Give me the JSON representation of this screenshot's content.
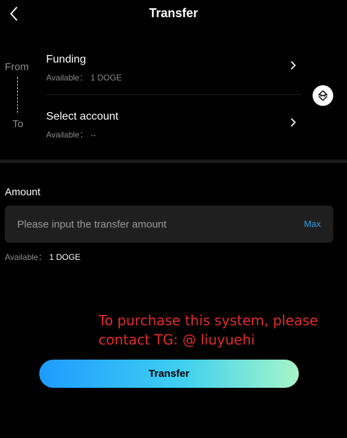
{
  "header": {
    "title": "Transfer",
    "back_icon": "chevron-left-icon"
  },
  "transfer": {
    "from_label": "From",
    "to_label": "To",
    "from_account": {
      "name": "Funding",
      "available_key": "Available：",
      "available_value": "1 DOGE"
    },
    "to_account": {
      "name": "Select account",
      "available_key": "Available：",
      "available_value": "--"
    },
    "swap_icon": "swap-icon"
  },
  "amount": {
    "label": "Amount",
    "placeholder": "Please input the transfer amount",
    "value": "",
    "max_label": "Max",
    "available_key": "Available：",
    "available_value": "1 DOGE"
  },
  "promo": {
    "text": "To purchase this system, please contact TG: @ liuyuehi"
  },
  "submit": {
    "label": "Transfer"
  },
  "colors": {
    "background": "#000000",
    "accent_blue": "#2e9cf2",
    "gradient_start": "#1e9bff",
    "gradient_end": "#a6f6c7",
    "promo_red": "#e42b2b",
    "muted_text": "#8b8b8b",
    "input_bg": "#1f1f1f"
  }
}
